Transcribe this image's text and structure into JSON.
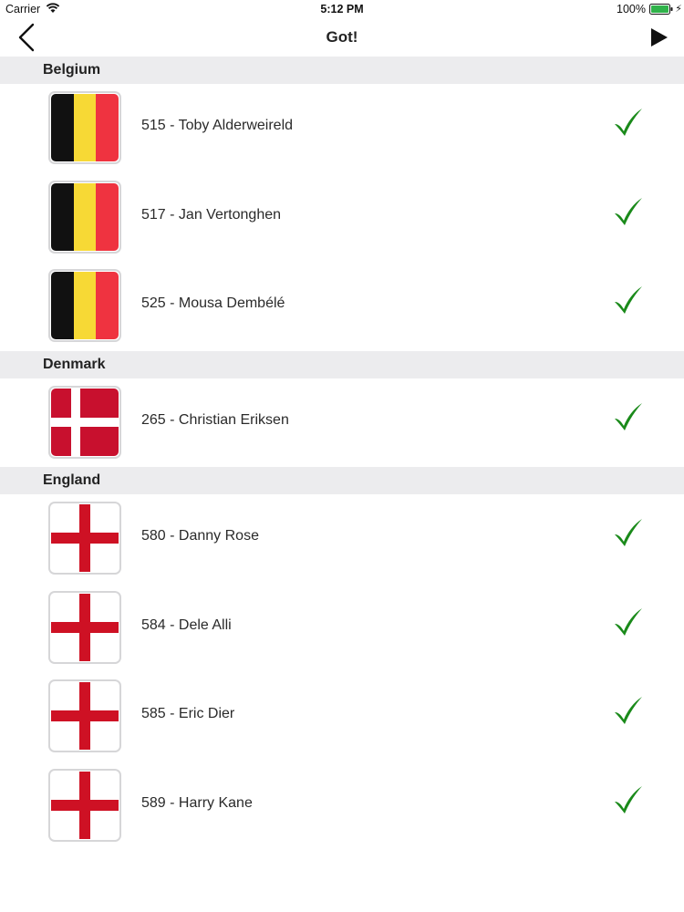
{
  "status_bar": {
    "carrier": "Carrier",
    "time": "5:12 PM",
    "battery": "100%"
  },
  "nav": {
    "title": "Got!",
    "back_icon": "chevron-left-icon",
    "play_icon": "play-icon"
  },
  "colors": {
    "belgium": [
      "#111111",
      "#f7d935",
      "#ef3340"
    ],
    "denmark": [
      "#c8102e",
      "#ffffff"
    ],
    "england": [
      "#ffffff",
      "#ce1124"
    ],
    "check": "#1a8a1a",
    "section_bg": "#ececee"
  },
  "sections": [
    {
      "country": "Belgium",
      "players": [
        "515 - Toby Alderweireld",
        "517 - Jan Vertonghen",
        "525 - Mousa Dembélé"
      ]
    },
    {
      "country": "Denmark",
      "players": [
        "265 - Christian Eriksen"
      ]
    },
    {
      "country": "England",
      "players": [
        "580 - Danny Rose",
        "584 - Dele Alli",
        "585 - Eric Dier",
        "589 - Harry Kane"
      ]
    }
  ]
}
